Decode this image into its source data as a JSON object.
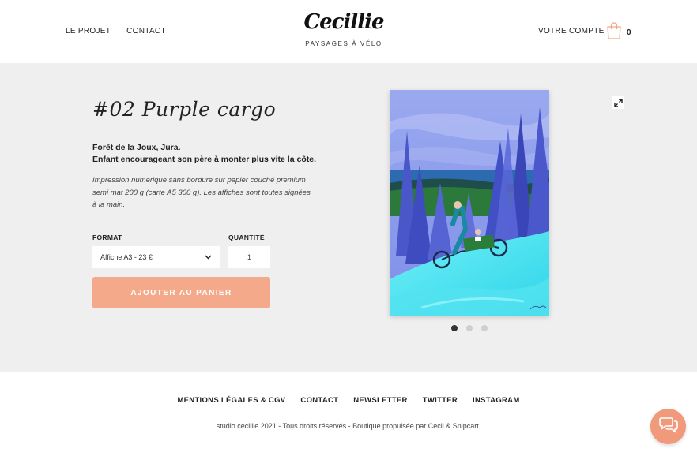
{
  "header": {
    "nav_left": [
      "LE PROJET",
      "CONTACT"
    ],
    "logo": {
      "name": "Cecillie",
      "subtitle": "PAYSAGES À VÉLO"
    },
    "account": "VOTRE COMPTE",
    "cart_count": "0",
    "cart_icon": "shopping-bag-icon"
  },
  "product": {
    "title": "#02 Purple cargo",
    "lead_line1": "Forêt de la Joux, Jura.",
    "lead_line2": "Enfant encourageant son père à monter plus vite la côte.",
    "description": "Impression numérique sans bordure sur papier couché premium semi mat 200 g (carte A5 300 g). Les affiches sont toutes signées à la main.",
    "format_label": "FORMAT",
    "format_selected": "Affiche A3 - 23 €",
    "quantity_label": "QUANTITÉ",
    "quantity_value": "1",
    "add_to_cart": "AJOUTER AU PANIER",
    "accent_color": "#f4a98a",
    "gallery_dots": 3,
    "gallery_active_index": 0,
    "expand_icon": "expand-arrows-icon"
  },
  "footer": {
    "links": [
      "MENTIONS LÉGALES & CGV",
      "CONTACT",
      "NEWSLETTER",
      "TWITTER",
      "INSTAGRAM"
    ],
    "copyright": "studio cecillie 2021 - Tous droits réservés - Boutique propulsée par Cecil & Snipcart.",
    "chat_icon": "chat-bubbles-icon",
    "chat_color": "#f19a7b"
  }
}
